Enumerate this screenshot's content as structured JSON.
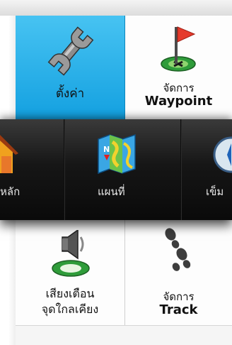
{
  "menu": {
    "settings_label": "ตั้งค่า",
    "waypoint_label_line1": "จัดการ",
    "waypoint_label_line2": "Waypoint",
    "home_label_partial": "หลัก",
    "map_label": "แผนที่",
    "compass_label_partial": "เข็ม",
    "alarm_label_line1": "เสียงเตือน",
    "alarm_label_line2": "จุดใกลเคียง",
    "track_label_line1": "จัดการ",
    "track_label_line2": "Track"
  },
  "icons": {
    "settings": "wrench-icon",
    "waypoint": "flag-icon",
    "home": "house-icon",
    "map": "map-icon",
    "compass": "compass-icon",
    "alarm": "speaker-icon",
    "track": "footprints-icon"
  },
  "colors": {
    "selected_tile": "#1fa8e6",
    "dark_band": "#111111",
    "flag_red": "#e53b2c",
    "target_green": "#3fb44a"
  }
}
